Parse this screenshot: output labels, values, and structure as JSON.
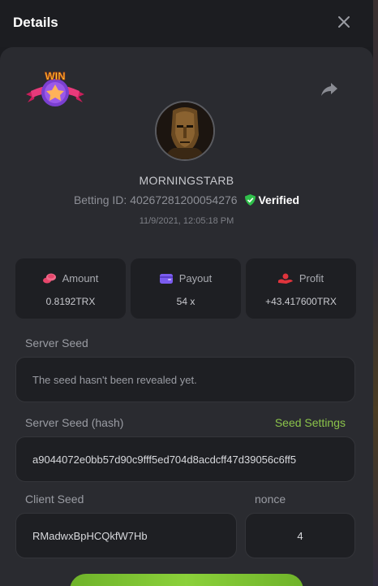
{
  "header": {
    "title": "Details"
  },
  "bet": {
    "badge": "WIN",
    "username": "MORNINGSTARB",
    "betting_id_label": "Betting ID:",
    "betting_id": "40267281200054276",
    "verified_label": "Verified",
    "timestamp": "11/9/2021, 12:05:18 PM"
  },
  "stats": {
    "amount": {
      "label": "Amount",
      "value": "0.8192TRX",
      "icon": "coins-icon",
      "color": "#e8466b"
    },
    "payout": {
      "label": "Payout",
      "value": "54 x",
      "icon": "wallet-icon",
      "color": "#7b5cf0"
    },
    "profit": {
      "label": "Profit",
      "value": "+43.417600TRX",
      "icon": "hand-coins-icon",
      "color": "#e0343c"
    }
  },
  "server_seed": {
    "label": "Server Seed",
    "value": "The seed hasn't been revealed yet."
  },
  "server_seed_hash": {
    "label": "Server Seed (hash)",
    "link": "Seed Settings",
    "value": "a9044072e0bb57d90c9fff5ed704d8acdcff47d39056c6ff5"
  },
  "client_seed": {
    "label": "Client Seed",
    "value": "RMadwxBpHCQkfW7Hb"
  },
  "nonce": {
    "label": "nonce",
    "value": "4"
  },
  "colors": {
    "accent_green": "#8bc34a",
    "verified_green": "#2fbf4a",
    "panel": "#2a2b30",
    "field": "#1e1f23"
  }
}
